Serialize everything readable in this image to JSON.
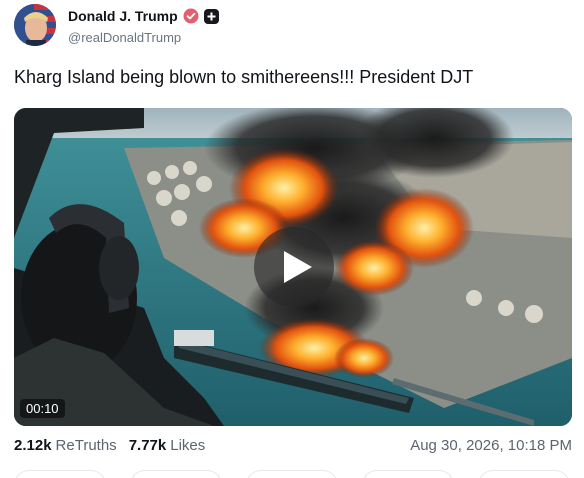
{
  "post": {
    "author_name": "Donald J. Trump",
    "author_handle": "@realDonaldTrump",
    "text": "Kharg Island being blown to smithereens!!! President DJT",
    "video_duration": "00:10",
    "retruths_count": "2.12k",
    "retruths_label": "ReTruths",
    "likes_count": "7.77k",
    "likes_label": "Likes",
    "timestamp": "Aug 30, 2026, 10:18 PM"
  },
  "icons": {
    "verified": "verified-badge-icon",
    "plus": "plus-badge-icon",
    "play": "play-icon"
  },
  "colors": {
    "verified_badge": "#e2606f",
    "handle_text": "#697583",
    "stat_label": "#5b6571"
  }
}
